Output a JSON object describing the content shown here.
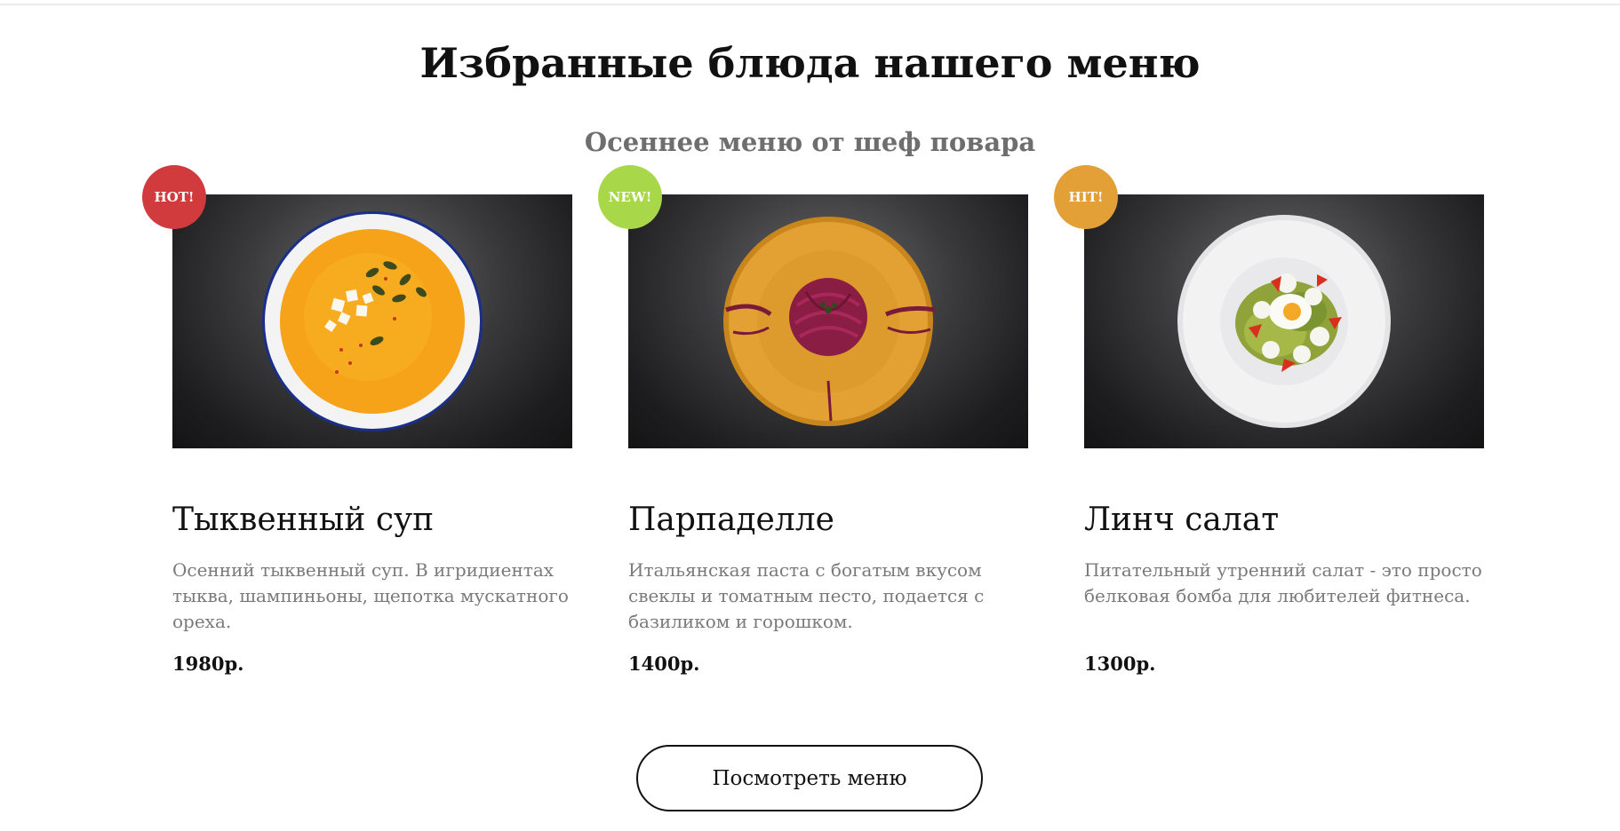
{
  "section": {
    "title": "Избранные блюда нашего меню",
    "subtitle": "Осеннее меню от шеф повара"
  },
  "dishes": [
    {
      "badge": "HOT!",
      "badge_color": "#d23b3d",
      "name": "Тыквенный суп",
      "description": "Осенний тыквенный суп. В игридиентах тыква, шампиньоны, щепотка мускатного ореха.",
      "price": "1980р."
    },
    {
      "badge": "NEW!",
      "badge_color": "#a8d84a",
      "name": "Парпаделле",
      "description": "Итальянская паста с богатым вкусом свеклы и томатным песто, подается с базиликом и горошком.",
      "price": "1400р."
    },
    {
      "badge": "HIT!",
      "badge_color": "#e2a036",
      "name": "Линч салат",
      "description": "Питательный утренний салат - это просто белковая бомба для любителей фитнеса.",
      "price": "1300р."
    }
  ],
  "button": {
    "label": "Посмотреть меню"
  }
}
